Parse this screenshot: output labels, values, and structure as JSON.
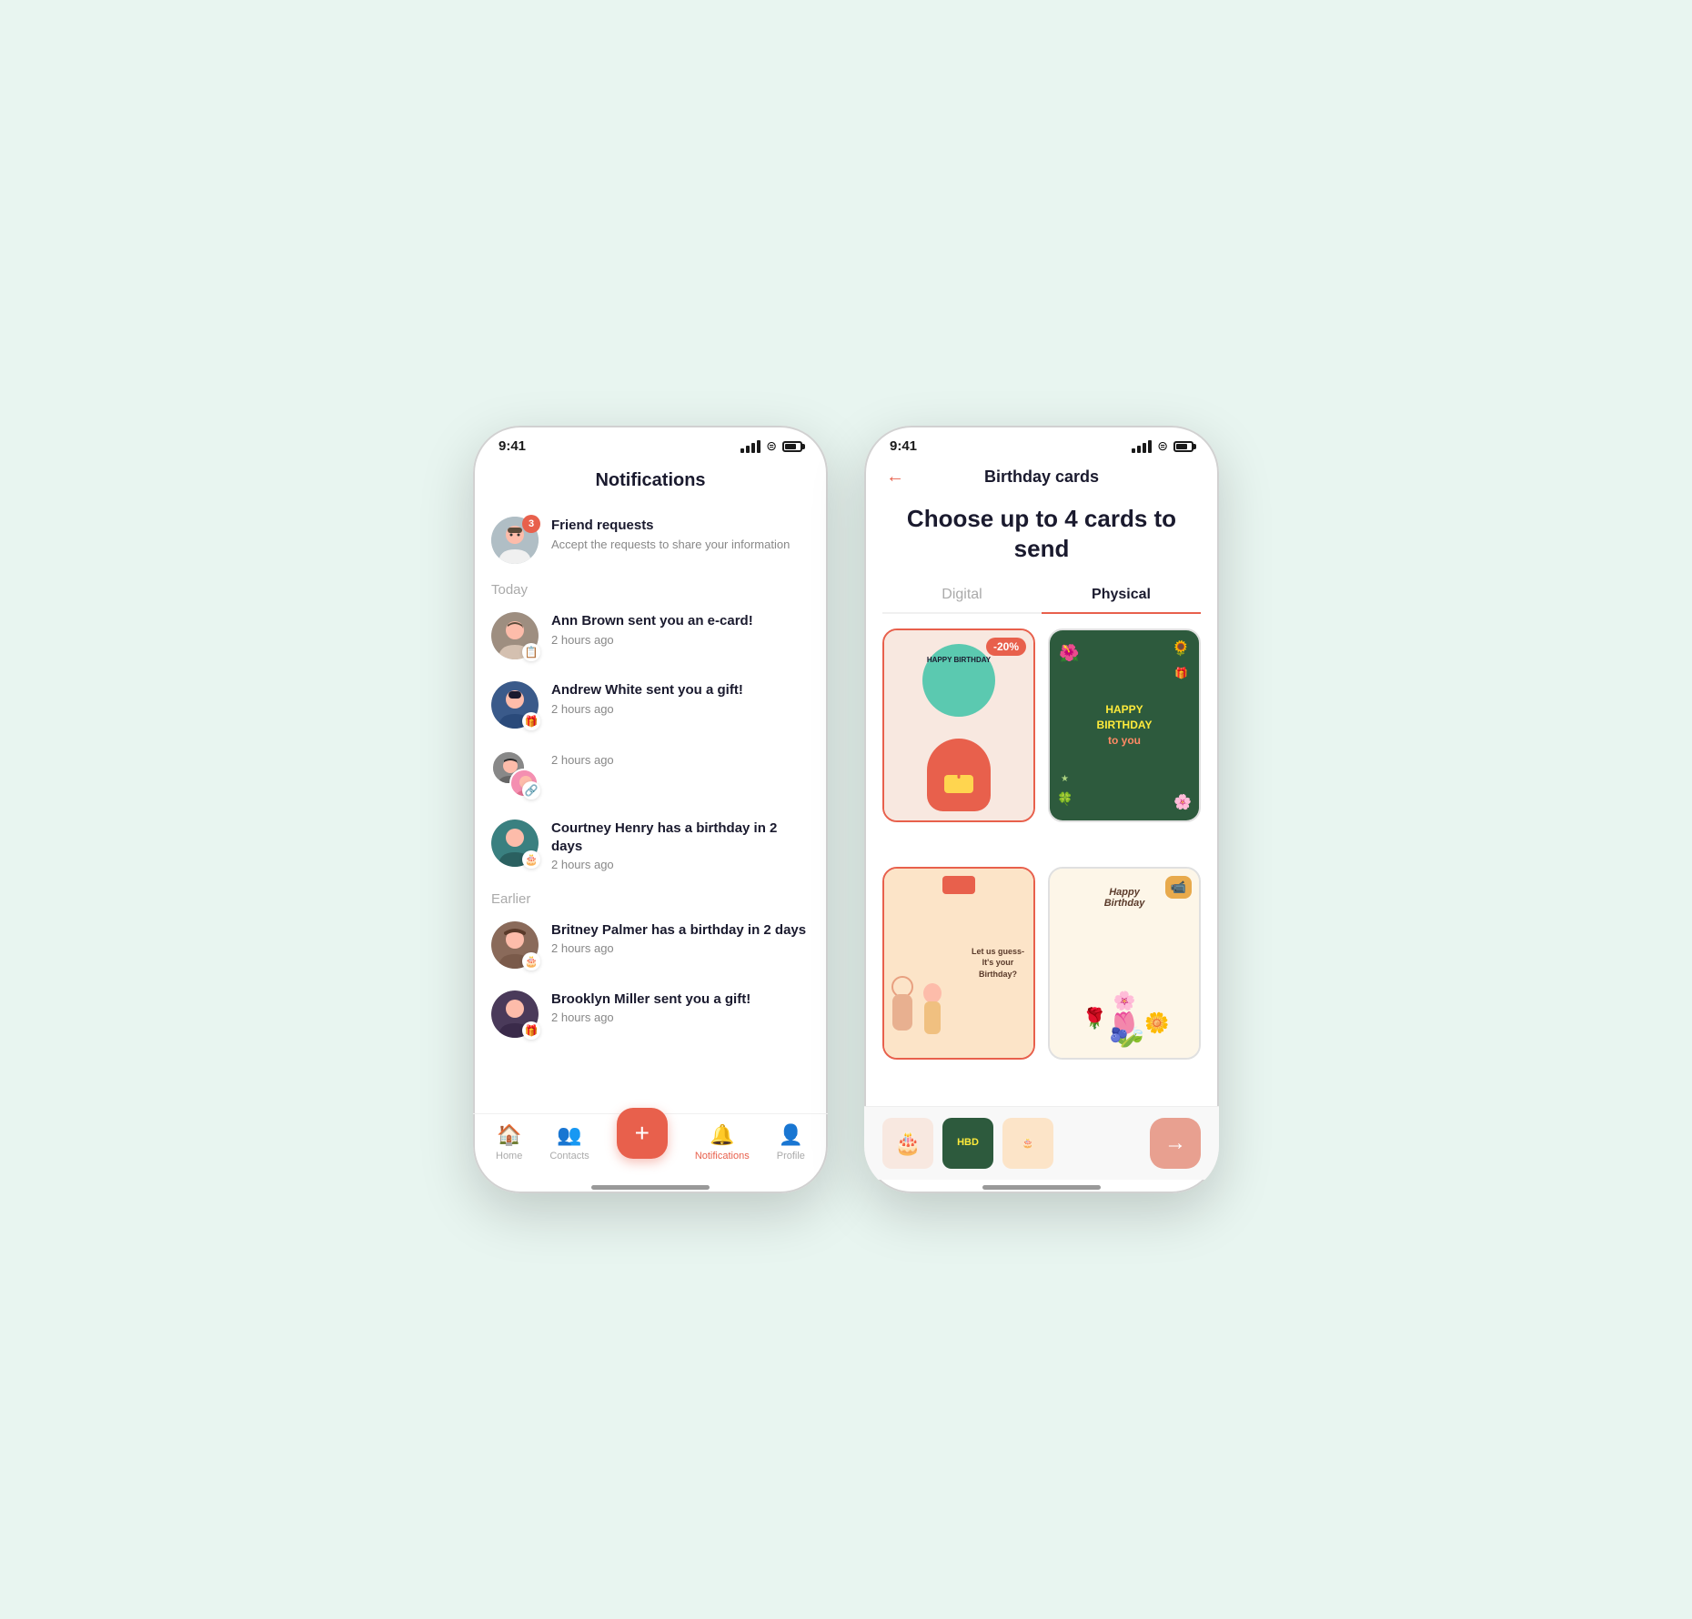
{
  "left_phone": {
    "status_time": "9:41",
    "screen_title": "Notifications",
    "friend_request": {
      "title": "Friend requests",
      "subtitle": "Accept the requests to share your information",
      "badge_count": "3"
    },
    "section_today": "Today",
    "section_earlier": "Earlier",
    "notifications": [
      {
        "id": "ann-brown",
        "title": "Ann Brown sent you an e-card!",
        "subtitle": "2 hours ago",
        "icon": "📧",
        "avatar_color": "#b0bec5"
      },
      {
        "id": "andrew-white",
        "title": "Andrew White sent you a gift!",
        "subtitle": "2 hours ago",
        "icon": "🎁",
        "avatar_color": "#5c7bd4"
      },
      {
        "id": "unknown",
        "title": "",
        "subtitle": "2 hours ago",
        "icon": "🔗",
        "avatar_color": "#f48fb1"
      },
      {
        "id": "courtney-henry",
        "title": "Courtney Henry has a birthday in 2 days",
        "subtitle": "2 hours ago",
        "icon": "🎂",
        "avatar_color": "#4db6ac"
      },
      {
        "id": "britney-palmer",
        "title": "Britney Palmer has a birthday in 2 days",
        "subtitle": "2 hours ago",
        "icon": "🎂",
        "avatar_color": "#a1887f"
      },
      {
        "id": "brooklyn-miller",
        "title": "Brooklyn Miller sent you a gift!",
        "subtitle": "2 hours ago",
        "icon": "🎁",
        "avatar_color": "#9575cd"
      }
    ],
    "nav": {
      "home": "Home",
      "contacts": "Contacts",
      "notifications": "Notifications",
      "profile": "Profile"
    }
  },
  "right_phone": {
    "status_time": "9:41",
    "header_title": "Birthday cards",
    "main_title": "Choose up to 4 cards to send",
    "tabs": [
      "Digital",
      "Physical"
    ],
    "active_tab": "Physical",
    "cards": [
      {
        "id": "card1",
        "discount": "-20%",
        "bg": "#f8e8e0",
        "selected": true
      },
      {
        "id": "card2",
        "bg": "#2d5a3d",
        "selected": false
      },
      {
        "id": "card3",
        "bg": "#fce4c8",
        "selected": true
      },
      {
        "id": "card4",
        "bg": "#fdf6e8",
        "video_badge": "📹",
        "selected": false
      }
    ],
    "preview_thumbs": [
      "card1",
      "card2",
      "card3"
    ],
    "next_button_label": "→"
  }
}
